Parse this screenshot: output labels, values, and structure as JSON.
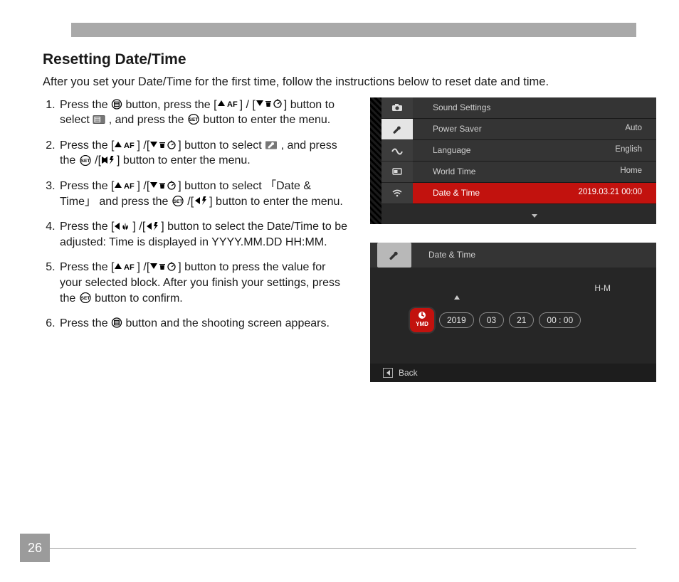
{
  "page_number": "26",
  "heading": "Resetting Date/Time",
  "intro": "After you set your Date/Time for the first time, follow the instructions below to reset date and time.",
  "steps": {
    "s1a": "Press the ",
    "s1b": " button, press the [",
    "s1c": "] / [",
    "s1d": "] button to select ",
    "s1e": " , and press the ",
    "s1f": " button to enter the menu.",
    "s2a": "Press the [",
    "s2b": "] /[",
    "s2c": "] button to select ",
    "s2d": " , and press the ",
    "s2e": " /[",
    "s2f": "] button to enter the menu.",
    "s3a": "Press the [",
    "s3b": "] /[",
    "s3c": "] button to select 「Date & Time」 and press the ",
    "s3d": " /[",
    "s3e": "] button to enter the menu.",
    "s4a": "Press the [",
    "s4b": "] /[",
    "s4c": "] button to select the Date/Time to be adjusted: Time is displayed in YYYY.MM.DD HH:MM.",
    "s5a": "Press the [",
    "s5b": "] /[",
    "s5c": "] button to press the value for your selected block. After you finish your settings, press the ",
    "s5d": " button to confirm.",
    "s6a": "Press the ",
    "s6b": " button and the shooting screen appears."
  },
  "menu": {
    "rows": [
      {
        "label": "Sound Settings",
        "value": ""
      },
      {
        "label": "Power Saver",
        "value": "Auto"
      },
      {
        "label": "Language",
        "value": "English"
      },
      {
        "label": "World Time",
        "value": "Home"
      },
      {
        "label": "Date & Time",
        "value": "2019.03.21 00:00"
      }
    ]
  },
  "dt": {
    "title": "Date & Time",
    "hm": "H-M",
    "ymd": "YMD",
    "year": "2019",
    "month": "03",
    "day": "21",
    "time": "00 : 00",
    "back": "Back"
  }
}
